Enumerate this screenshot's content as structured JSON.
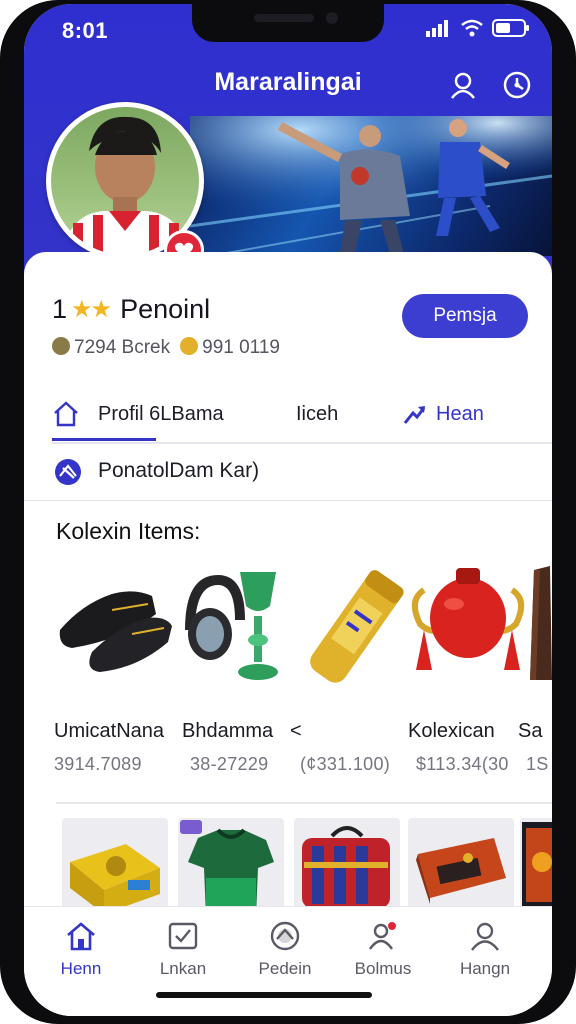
{
  "status_bar": {
    "time": "8:01"
  },
  "header": {
    "title": "Mararalingai",
    "icons": [
      "profile-search-icon",
      "settings-icon"
    ]
  },
  "profile": {
    "rank": "1",
    "stars": "★★",
    "name": "Penoinl",
    "stat1": "7294 Bcrek",
    "stat2": "991 0119",
    "action_label": "Pemsja",
    "badge_icon": "heart-icon"
  },
  "tabs": [
    {
      "label": "Profil 6LBama",
      "icon": "home-outline-icon",
      "active": true
    },
    {
      "label": "Iiceh",
      "active": false
    },
    {
      "label": "Hean",
      "icon": "trend-arrow-icon",
      "active": false
    }
  ],
  "link_row": {
    "label": "PonatolDam Kar)",
    "icon": "ball-icon"
  },
  "section": {
    "title": "Kolexin Items:"
  },
  "items": [
    {
      "name": "UmicatNana",
      "price": "3914.7089",
      "icon": "boots-icon"
    },
    {
      "name": "Bhdamma",
      "price": "38-27229",
      "icon": "trophy-headphones-icon"
    },
    {
      "name": "<",
      "price": "(¢331.100)",
      "icon": "bottle-icon"
    },
    {
      "name": "Kolexican",
      "price": "$113.34(30",
      "icon": "trophy-cup-icon"
    },
    {
      "name": "Sa",
      "price": "1S",
      "icon": "item-icon"
    }
  ],
  "thumbnails": [
    "cards-box-icon",
    "jersey-icon",
    "bag-icon",
    "case-icon",
    "card-icon"
  ],
  "bottom_nav": [
    {
      "label": "Henn",
      "icon": "home-icon",
      "active": true
    },
    {
      "label": "Lnkan",
      "icon": "checkbox-icon",
      "active": false
    },
    {
      "label": "Pedein",
      "icon": "ball-icon",
      "active": false
    },
    {
      "label": "Bolmus",
      "icon": "user-badge-icon",
      "active": false
    },
    {
      "label": "Hangn",
      "icon": "user-icon",
      "active": false
    }
  ],
  "colors": {
    "primary": "#3434c8",
    "accent": "#e0273a",
    "star": "#f3b623"
  }
}
